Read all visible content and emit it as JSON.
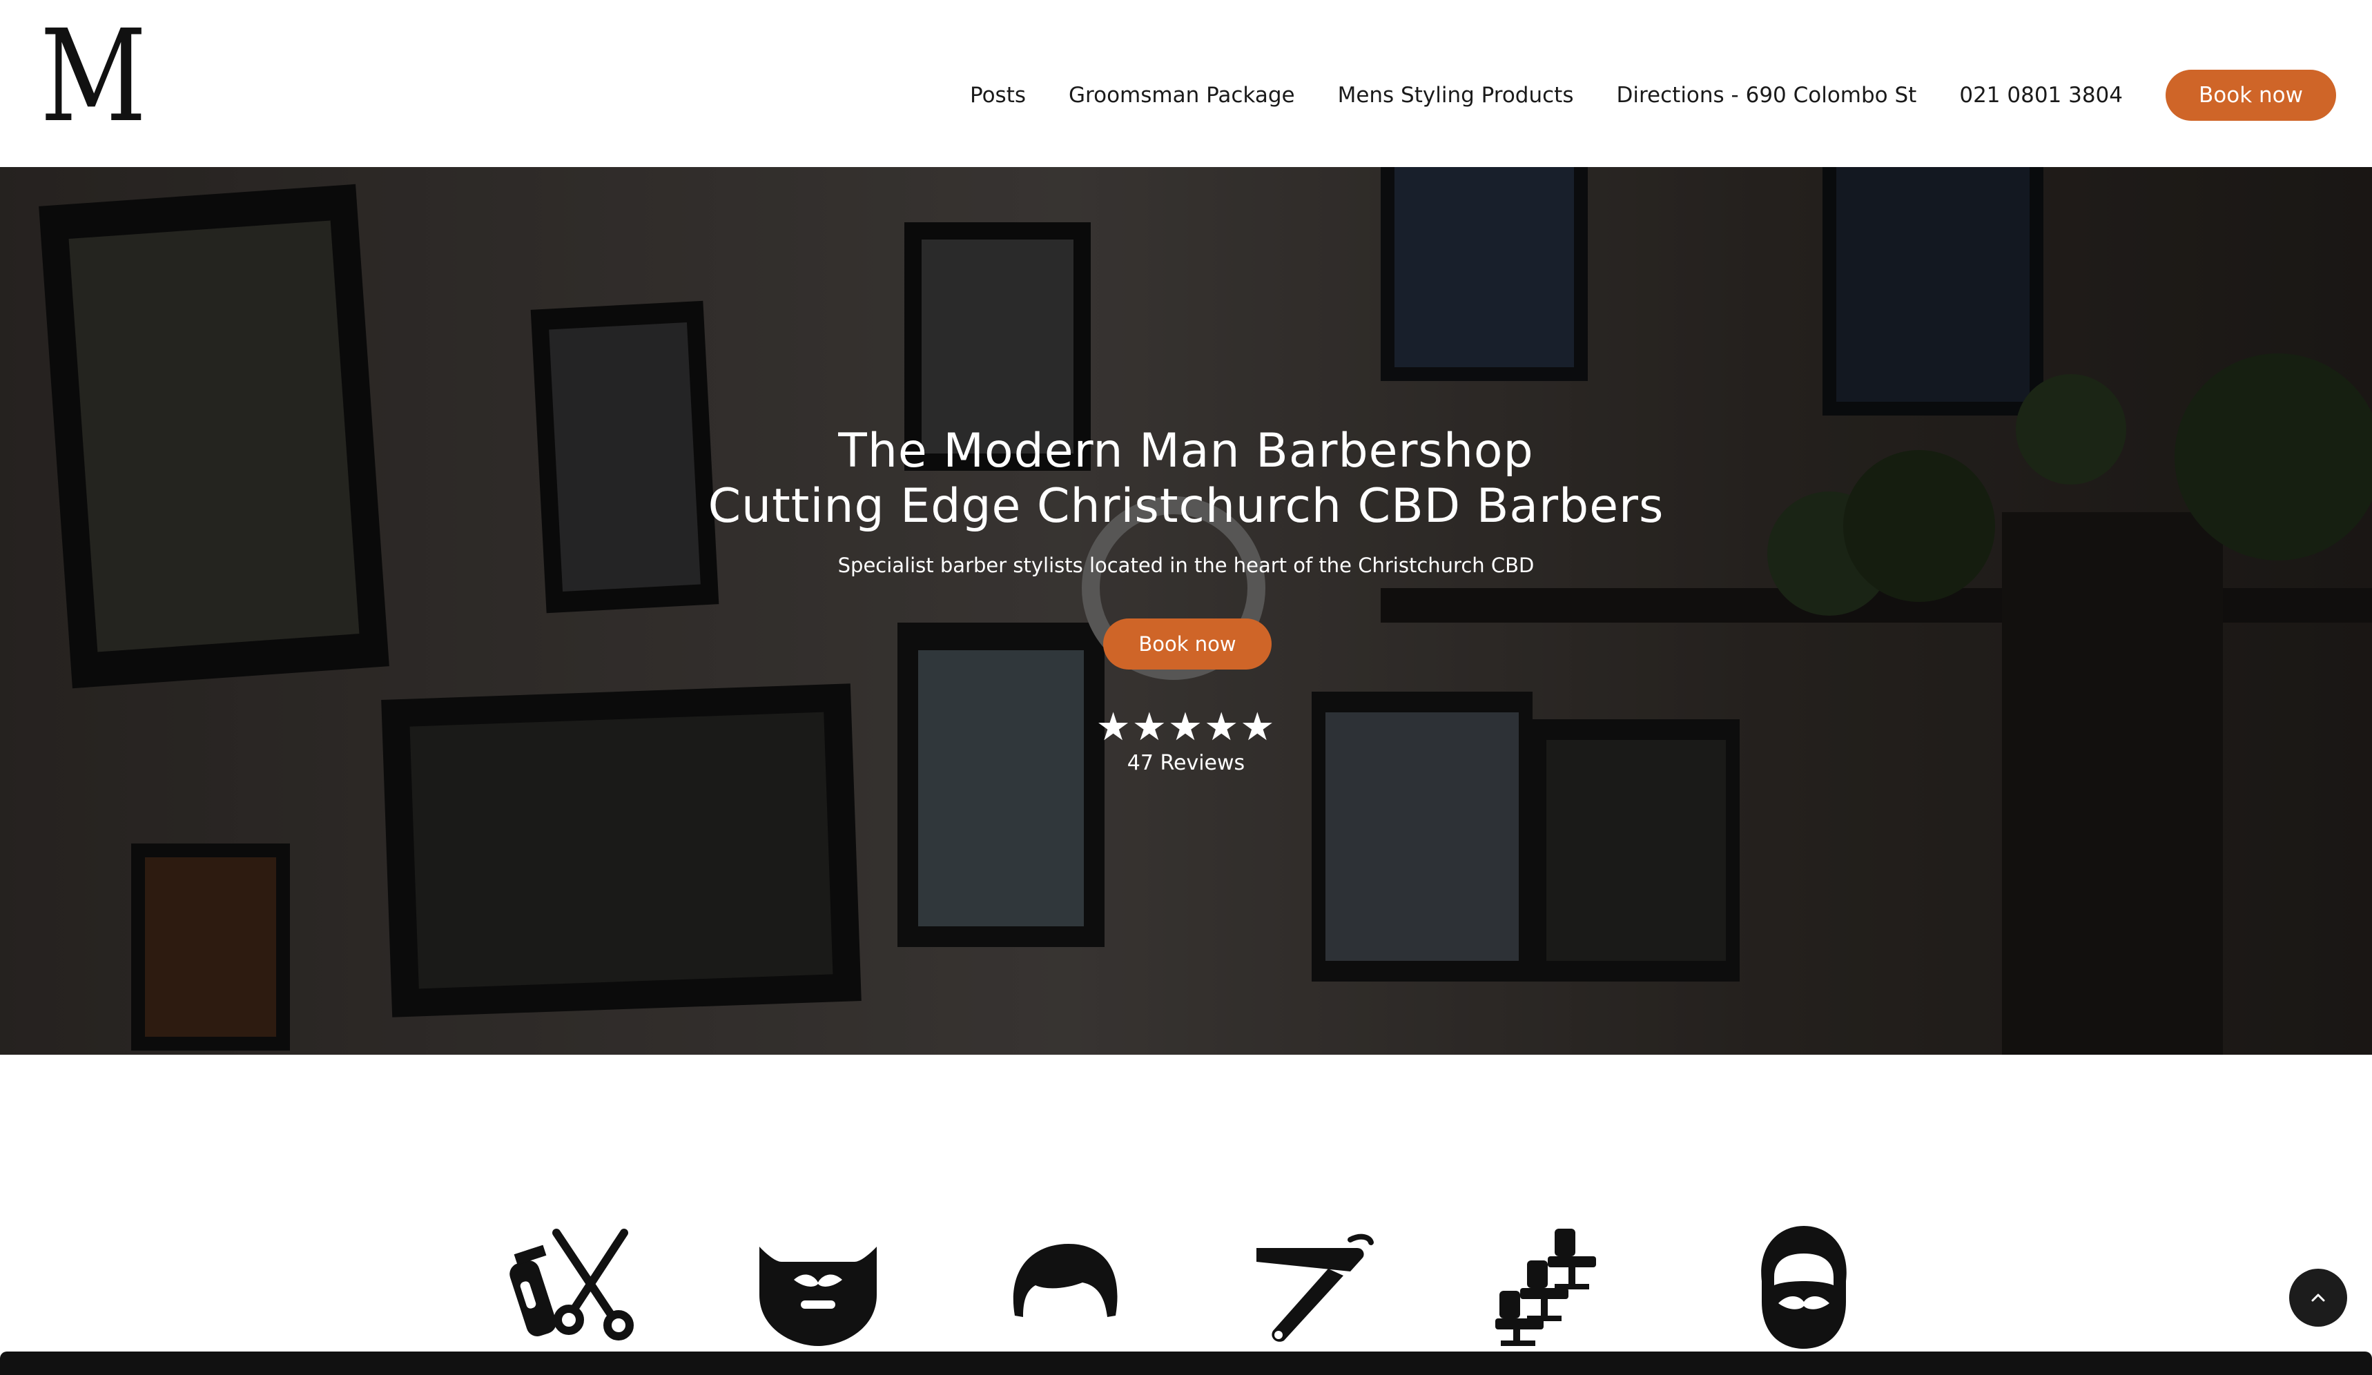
{
  "brand": {
    "logo_letter": "M"
  },
  "nav": {
    "items": [
      {
        "label": "Posts"
      },
      {
        "label": "Groomsman Package"
      },
      {
        "label": "Mens Styling Products"
      },
      {
        "label": "Directions - 690 Colombo St"
      },
      {
        "label": "021 0801 3804"
      }
    ],
    "book_label": "Book now"
  },
  "hero": {
    "title_line1": "The Modern Man Barbershop",
    "title_line2": "Cutting Edge Christchurch CBD Barbers",
    "subtitle": "Specialist barber stylists located in the heart of the Christchurch CBD",
    "button_label": "Book now",
    "rating_stars": "★★★★★",
    "rating": 5,
    "reviews_text": "47 Reviews"
  },
  "services": {
    "icons": [
      "clipper-scissors-icon",
      "beard-icon",
      "hair-icon",
      "straight-razor-icon",
      "barber-chairs-icon",
      "bearded-face-icon"
    ]
  },
  "colors": {
    "accent": "#cf6528",
    "text": "#1a1a1a",
    "hero_overlay": "#2b2724"
  }
}
